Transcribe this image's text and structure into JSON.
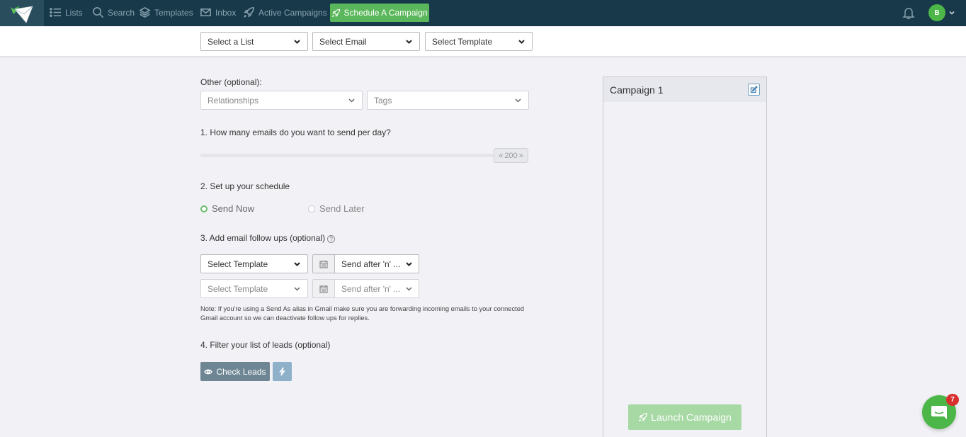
{
  "nav": {
    "items": [
      {
        "label": "Lists",
        "icon": "list-icon"
      },
      {
        "label": "Search",
        "icon": "search-icon"
      },
      {
        "label": "Templates",
        "icon": "layers-icon"
      },
      {
        "label": "Inbox",
        "icon": "envelope-icon"
      },
      {
        "label": "Active Campaigns",
        "icon": "rocket-icon"
      }
    ],
    "schedule_button": "Schedule A Campaign",
    "avatar_initial": "B"
  },
  "subbar": {
    "list_select": "Select a List",
    "email_select": "Select Email",
    "template_select": "Select Template"
  },
  "form": {
    "other_label": "Other (optional):",
    "relationships_select": "Relationships",
    "tags_select": "Tags",
    "step1_label": "1. How many emails do you want to send per day?",
    "emails_per_day": "200",
    "step2_label": "2. Set up your schedule",
    "send_now": "Send Now",
    "send_later": "Send Later",
    "step3_label": "3. Add email follow ups (optional)",
    "followups": [
      {
        "template": "Select Template",
        "delay": "Send after 'n' ..."
      },
      {
        "template": "Select Template",
        "delay": "Send after 'n' ..."
      }
    ],
    "note_line1": "Note: If you're using a Send As alias in Gmail make sure you are forwarding incoming emails to your connected",
    "note_line2": "Gmail account so we can deactivate follow ups for replies.",
    "step4_label": "4. Filter your list of leads (optional)",
    "check_leads": "Check Leads"
  },
  "panel": {
    "title": "Campaign 1",
    "launch_button": "Launch Campaign"
  },
  "chat": {
    "badge_count": "7"
  },
  "colors": {
    "nav_bg": "#17394a",
    "accent_green": "#5bb75b",
    "launch_disabled": "#a7d9a4",
    "check_leads_bg": "#6e8694"
  }
}
